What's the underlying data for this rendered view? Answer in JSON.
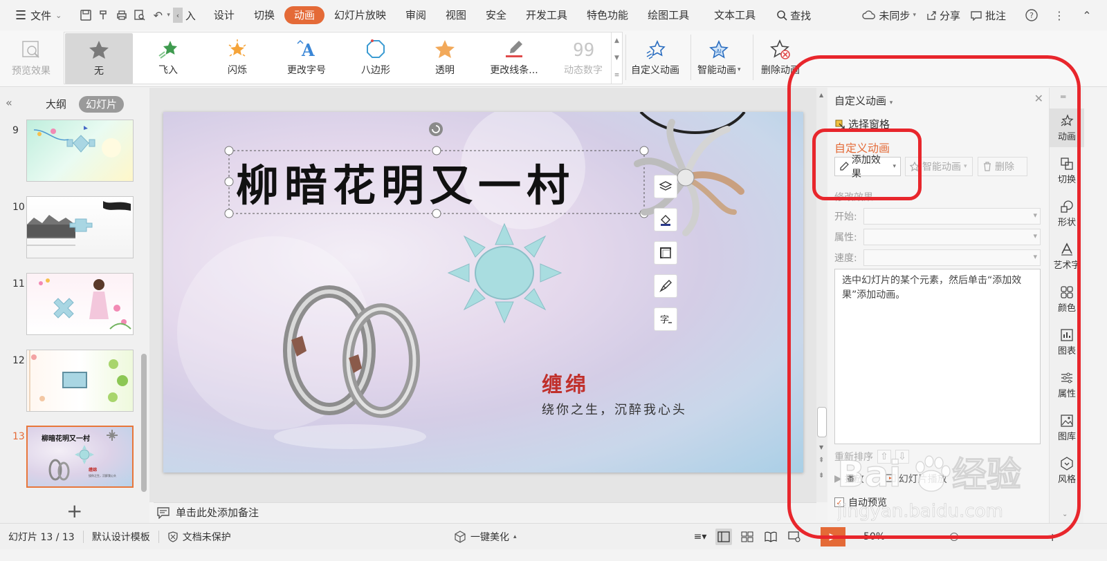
{
  "menubar": {
    "file": "文件",
    "partial_tab": "入",
    "tabs": [
      "设计",
      "切换",
      "动画",
      "幻灯片放映",
      "审阅",
      "视图",
      "安全",
      "开发工具",
      "特色功能",
      "绘图工具",
      "文本工具"
    ],
    "active_tab": "动画",
    "search": "查找",
    "sync": "未同步",
    "share": "分享",
    "annotate": "批注"
  },
  "ribbon": {
    "preview": "预览效果",
    "gallery": [
      {
        "label": "无",
        "icon": "star-gray-icon"
      },
      {
        "label": "飞入",
        "icon": "star-fly-icon"
      },
      {
        "label": "闪烁",
        "icon": "star-flash-icon"
      },
      {
        "label": "更改字号",
        "icon": "font-size-icon"
      },
      {
        "label": "八边形",
        "icon": "octagon-icon"
      },
      {
        "label": "透明",
        "icon": "star-transparent-icon"
      },
      {
        "label": "更改线条...",
        "icon": "line-color-icon"
      },
      {
        "label": "动态数字",
        "icon": "digit-icon"
      }
    ],
    "custom_animation": "自定义动画",
    "smart_animation": "智能动画",
    "delete_animation": "删除动画"
  },
  "leftpanel": {
    "outline_tab": "大纲",
    "slides_tab": "幻灯片",
    "slide_numbers": [
      "9",
      "10",
      "11",
      "12",
      "13"
    ],
    "current_slide": "13"
  },
  "slide": {
    "title": "柳暗花明又一村",
    "subtitle": "缠绵",
    "tagline": "绕你之生，沉醉我心头",
    "thumb_title": "柳暗花明又一村",
    "thumb_subtitle": "缠绵",
    "thumb_tagline": "绕你之生，沉醉我心头"
  },
  "notes": {
    "placeholder": "单击此处添加备注"
  },
  "anim_pane": {
    "title": "自定义动画",
    "select_pane": "选择窗格",
    "heading": "自定义动画",
    "add_effect": "添加效果",
    "smart_animation": "智能动画",
    "delete": "删除",
    "modify_label": "修改效果",
    "start_label": "开始:",
    "property_label": "属性:",
    "speed_label": "速度:",
    "hint": "选中幻灯片的某个元素，然后单击“添加效果”添加动画。",
    "reorder": "重新排序",
    "play": "播放",
    "slideshow": "幻灯片播放",
    "auto_preview": "自动预览"
  },
  "right_toolbar": [
    "动画",
    "切换",
    "形状",
    "艺术字",
    "颜色",
    "图表",
    "属性",
    "图库",
    "风格"
  ],
  "statusbar": {
    "slide_counter": "幻灯片 13 / 13",
    "template": "默认设计模板",
    "protection": "文档未保护",
    "beautify": "一键美化",
    "zoom": "50%"
  },
  "watermark": {
    "brand": "Bai",
    "brand_cn": "经验",
    "url": "jingyan.baidu.com"
  },
  "colors": {
    "accent": "#e46a37",
    "highlight": "#e8262c"
  }
}
